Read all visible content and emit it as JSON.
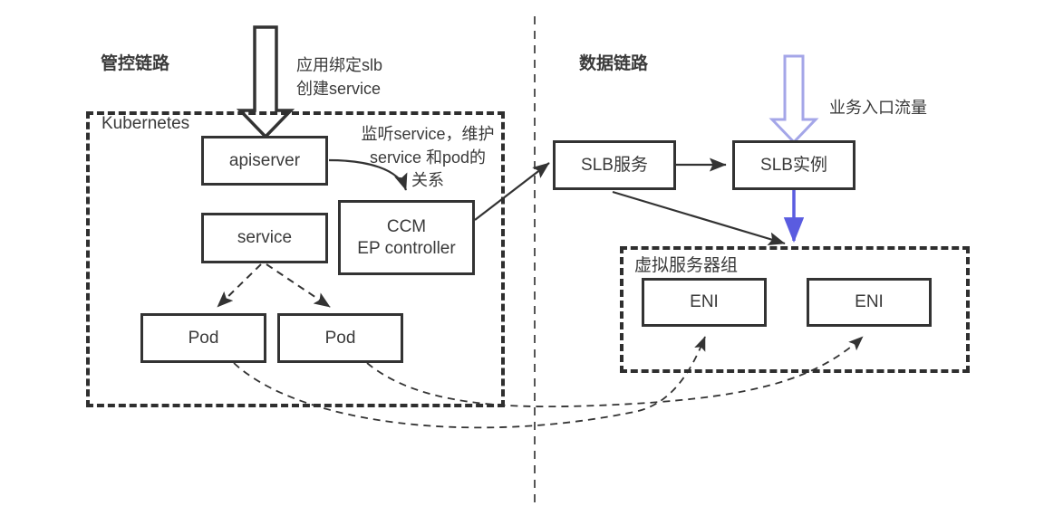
{
  "diagram": {
    "title_left": "管控链路",
    "title_right": "数据链路",
    "colors": {
      "stroke": "#333333",
      "text": "#3a3a3a",
      "block_arrow_light": "#a4a6e8",
      "arrow_blue": "#5a5ce0",
      "dashed_border": "#2f2f2f",
      "background": "#ffffff"
    }
  },
  "groups": {
    "kubernetes": {
      "label": "Kubernetes"
    },
    "vserver_group": {
      "label": "虚拟服务器组"
    }
  },
  "nodes": {
    "apiserver": {
      "label": "apiserver"
    },
    "service": {
      "label": "service"
    },
    "ccm": {
      "label": "CCM\nEP controller"
    },
    "pod_left": {
      "label": "Pod"
    },
    "pod_right": {
      "label": "Pod"
    },
    "slb_service": {
      "label": "SLB服务"
    },
    "slb_instance": {
      "label": "SLB实例"
    },
    "eni_left": {
      "label": "ENI"
    },
    "eni_right": {
      "label": "ENI"
    }
  },
  "annotations": {
    "bind_slb_create_service": "应用绑定slb\n创建service",
    "watch_service": "监听service，维护\nservice 和pod的\n关系",
    "ingress_traffic": "业务入口流量"
  }
}
